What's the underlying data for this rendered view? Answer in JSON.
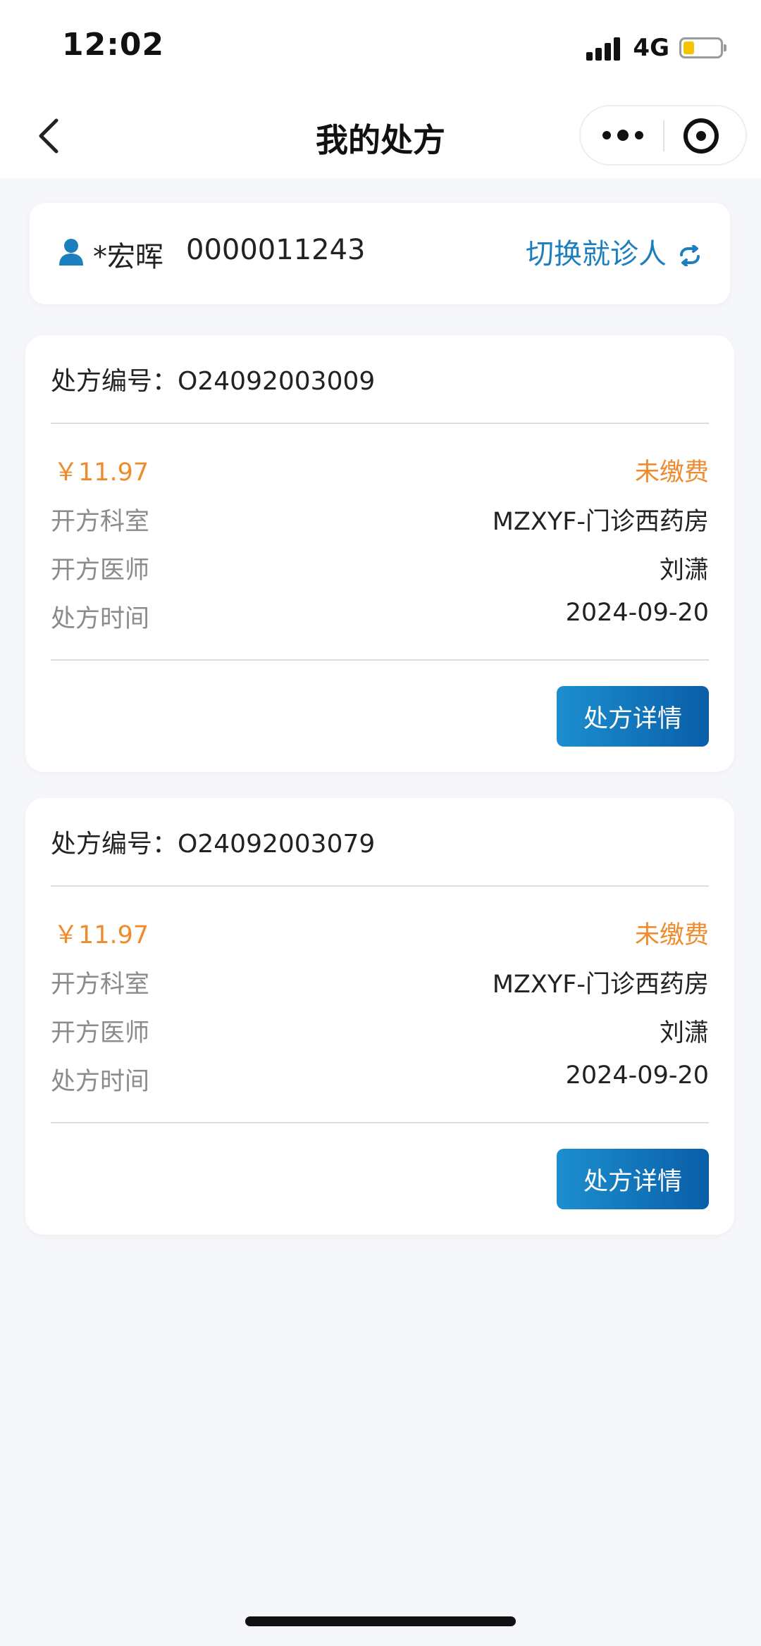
{
  "status_bar": {
    "time": "12:02",
    "network": "4G",
    "battery_level": 0.3
  },
  "nav": {
    "title": "我的处方",
    "back_icon": "chevron-left-icon",
    "more_icon": "more-dots-icon",
    "close_icon": "target-circle-icon"
  },
  "patient": {
    "name": "*宏晖",
    "id": "0000011243",
    "switch_label": "切换就诊人",
    "icon": "person-icon",
    "switch_icon": "refresh-icon",
    "accent_color": "#1b7ebf"
  },
  "prescriptions": [
    {
      "no_label": "处方编号：",
      "no": "O24092003009",
      "price": "￥11.97",
      "status": "未缴费",
      "dept_label": "开方科室",
      "dept": "MZXYF-门诊西药房",
      "doctor_label": "开方医师",
      "doctor": "刘潇",
      "time_label": "处方时间",
      "time": "2024-09-20",
      "button_label": "处方详情"
    },
    {
      "no_label": "处方编号：",
      "no": "O24092003079",
      "price": "￥11.97",
      "status": "未缴费",
      "dept_label": "开方科室",
      "dept": "MZXYF-门诊西药房",
      "doctor_label": "开方医师",
      "doctor": "刘潇",
      "time_label": "处方时间",
      "time": "2024-09-20",
      "button_label": "处方详情"
    }
  ],
  "colors": {
    "status_orange": "#ef8b2c",
    "button_blue": "#0a5ea8"
  }
}
